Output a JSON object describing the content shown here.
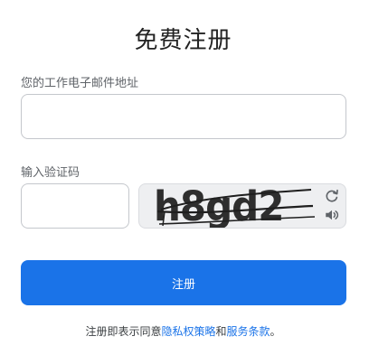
{
  "form": {
    "title": "免费注册",
    "email_label": "您的工作电子邮件地址",
    "email_value": "",
    "captcha_label": "输入验证码",
    "captcha_value": "",
    "captcha_text": "h8gd2",
    "refresh_icon": "refresh-icon",
    "audio_icon": "speaker-icon",
    "submit_label": "注册"
  },
  "terms": {
    "prefix": "注册即表示同意",
    "privacy_link": "隐私权策略",
    "conjunction": "和",
    "service_link": "服务条款",
    "suffix": "。"
  },
  "colors": {
    "accent": "#1a73e8",
    "captcha_text": "#2e2e2e",
    "captcha_bg": "#eeeff1"
  }
}
